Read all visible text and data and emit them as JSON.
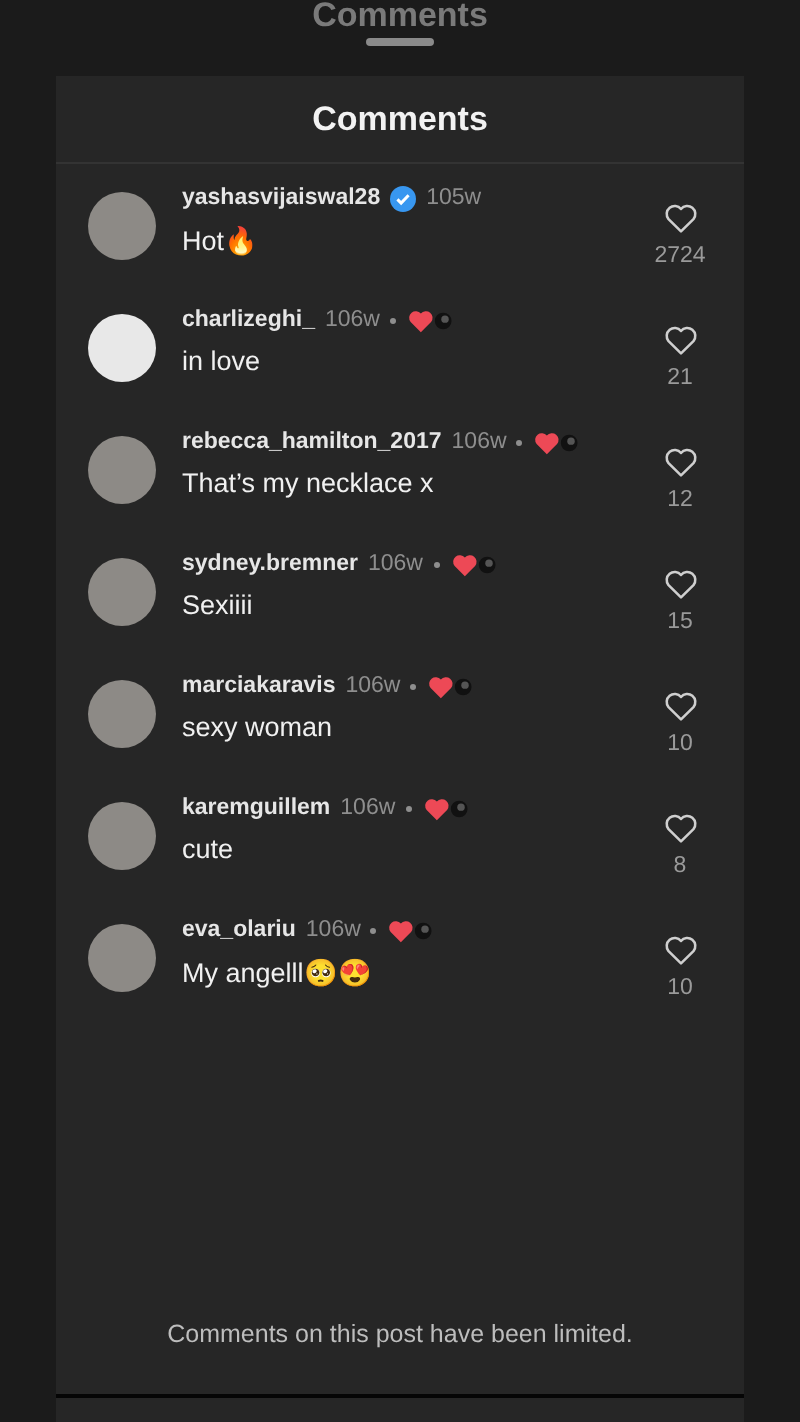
{
  "background_title": "Comments",
  "sheet": {
    "title": "Comments",
    "footer": "Comments on this post have been limited."
  },
  "comments": [
    {
      "username": "yashasvijaiswal28",
      "verified": true,
      "time": "105w",
      "liked_by_author": false,
      "text": "Hot🔥",
      "likes": "2724"
    },
    {
      "username": "charlizeghi_",
      "verified": false,
      "time": "106w",
      "liked_by_author": true,
      "text": "in love",
      "likes": "21"
    },
    {
      "username": "rebecca_hamilton_2017",
      "verified": false,
      "time": "106w",
      "liked_by_author": true,
      "text": "That’s my necklace x",
      "likes": "12"
    },
    {
      "username": "sydney.bremner",
      "verified": false,
      "time": "106w",
      "liked_by_author": true,
      "text": "Sexiiii",
      "likes": "15"
    },
    {
      "username": "marciakaravis",
      "verified": false,
      "time": "106w",
      "liked_by_author": true,
      "text": "sexy woman",
      "likes": "10"
    },
    {
      "username": "karemguillem",
      "verified": false,
      "time": "106w",
      "liked_by_author": true,
      "text": "cute",
      "likes": "8"
    },
    {
      "username": "eva_olariu",
      "verified": false,
      "time": "106w",
      "liked_by_author": true,
      "text": "My angelll🥺😍",
      "likes": "10"
    }
  ]
}
